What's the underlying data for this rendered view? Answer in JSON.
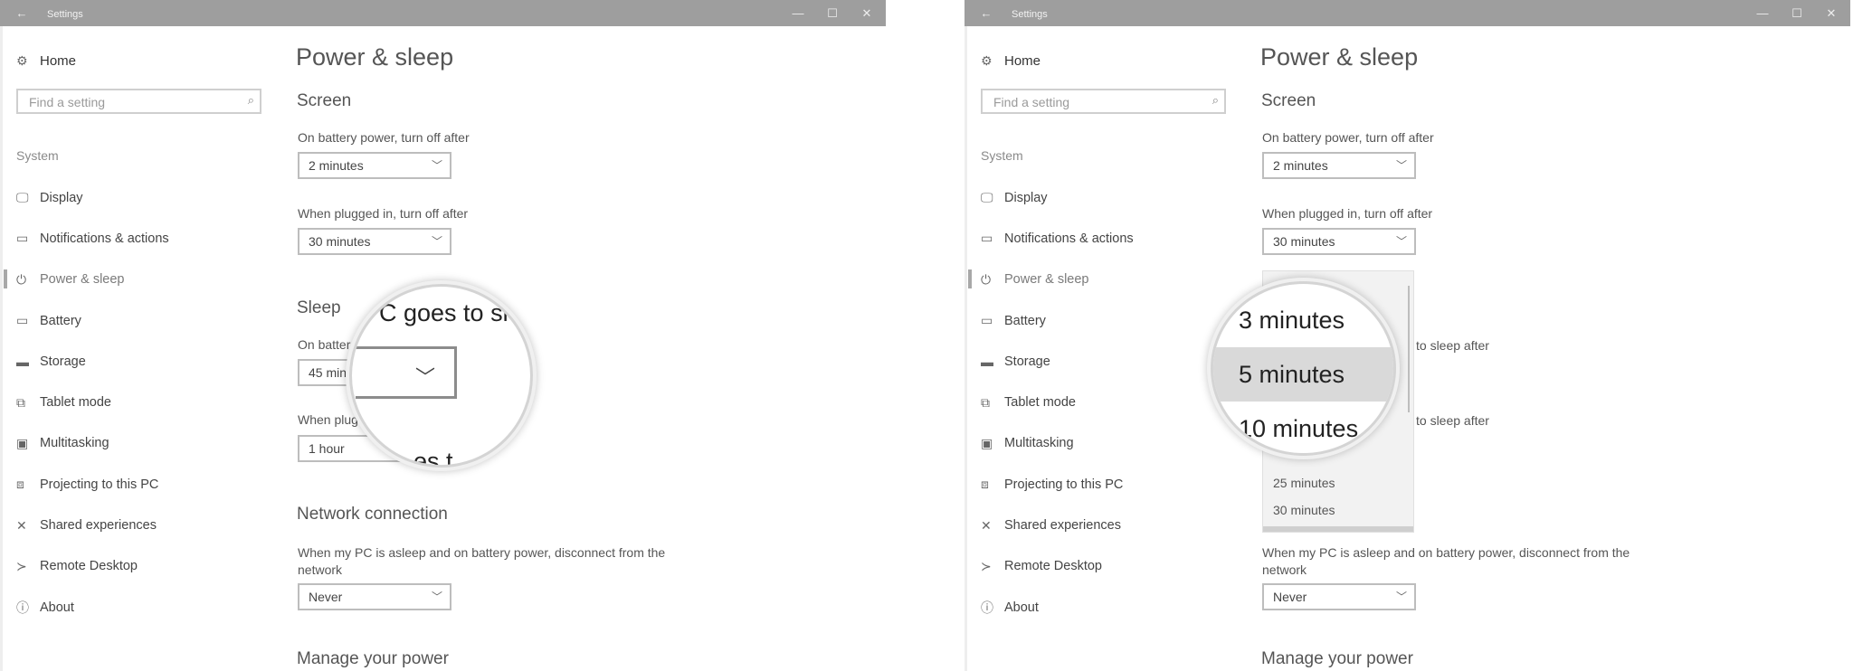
{
  "window_title": "Settings",
  "titlebar": {
    "back_icon": "←",
    "minimize_icon": "—",
    "maximize_icon": "☐",
    "close_icon": "✕"
  },
  "sidebar": {
    "home_label": "Home",
    "home_icon": "⚙",
    "search_placeholder": "Find a setting",
    "search_icon": "⌕",
    "group_label": "System",
    "items": [
      {
        "label": "Display",
        "icon": "🖵"
      },
      {
        "label": "Notifications & actions",
        "icon": "▭"
      },
      {
        "label": "Power & sleep",
        "icon": "⏻"
      },
      {
        "label": "Battery",
        "icon": "▭"
      },
      {
        "label": "Storage",
        "icon": "▬"
      },
      {
        "label": "Tablet mode",
        "icon": "⧉"
      },
      {
        "label": "Multitasking",
        "icon": "▣"
      },
      {
        "label": "Projecting to this PC",
        "icon": "⧈"
      },
      {
        "label": "Shared experiences",
        "icon": "✕"
      },
      {
        "label": "Remote Desktop",
        "icon": "≻"
      },
      {
        "label": "About",
        "icon": "ⓘ"
      }
    ]
  },
  "main": {
    "page_title": "Power & sleep",
    "screen_heading": "Screen",
    "screen_battery_label": "On battery power, turn off after",
    "screen_battery_value": "2 minutes",
    "screen_plugged_label": "When plugged in, turn off after",
    "screen_plugged_value": "30 minutes",
    "sleep_heading": "Sleep",
    "sleep_battery_label_visible": "On batter",
    "sleep_battery_value_visible": "45 min",
    "sleep_plugged_label_visible": "When plug",
    "sleep_plugged_value": "1 hour",
    "network_heading": "Network connection",
    "network_label": "When my PC is asleep and on battery power, disconnect from the network",
    "network_value": "Never",
    "manage_heading": "Manage your power",
    "sleep_after_text": "to sleep after"
  },
  "magnifier_left": {
    "text_top": "C goes to sl",
    "text_bottom": "es t"
  },
  "magnifier_right": {
    "items": [
      "3 minutes",
      "5 minutes",
      "10 minutes"
    ],
    "selected": "5 minutes"
  },
  "dropdown_list_right": {
    "items": [
      "25 minutes",
      "30 minutes"
    ]
  }
}
